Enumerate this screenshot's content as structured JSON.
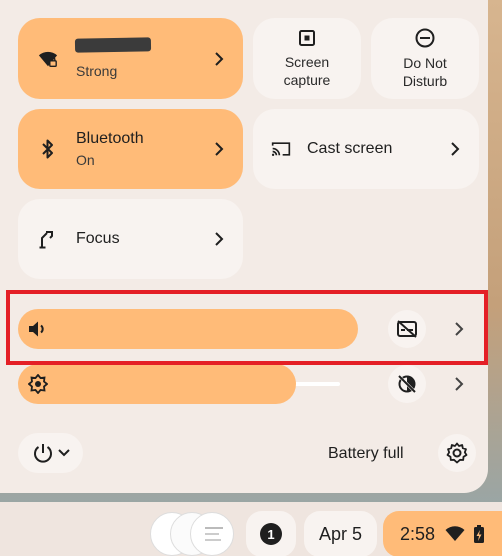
{
  "tiles": {
    "network": {
      "status": "Strong"
    },
    "screen_capture": {
      "label_line1": "Screen",
      "label_line2": "capture"
    },
    "dnd": {
      "label_line1": "Do Not",
      "label_line2": "Disturb"
    },
    "bluetooth": {
      "title": "Bluetooth",
      "status": "On"
    },
    "cast": {
      "title": "Cast screen"
    },
    "focus": {
      "title": "Focus"
    }
  },
  "sliders": {
    "volume": {
      "level": 0.89
    },
    "brightness": {
      "level": 0.85
    }
  },
  "footer": {
    "battery_text": "Battery full"
  },
  "shelf": {
    "notification_count": "1",
    "date": "Apr 5",
    "time": "2:58"
  },
  "colors": {
    "accent": "#ffbb78",
    "panel": "#f3ebe6",
    "highlight": "#e41f26"
  }
}
